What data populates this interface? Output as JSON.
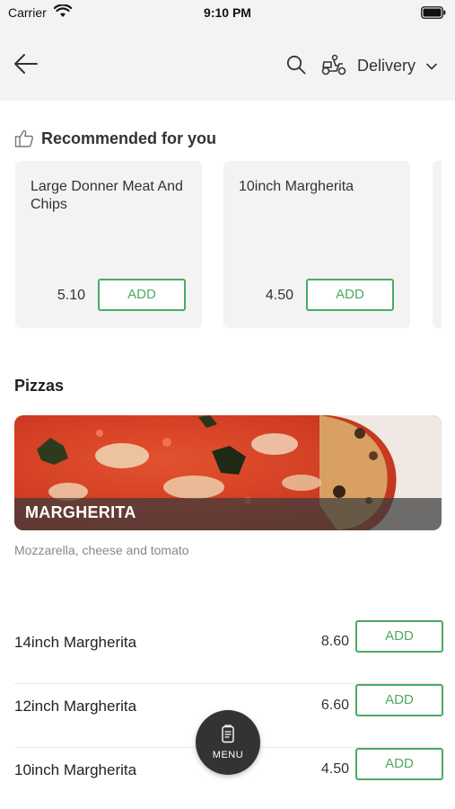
{
  "status_bar": {
    "carrier": "Carrier",
    "time": "9:10 PM"
  },
  "header": {
    "back_icon": "back-arrow-icon",
    "search_icon": "search-icon",
    "delivery_icon": "scooter-icon",
    "delivery_mode": "Delivery",
    "dropdown_icon": "chevron-down-icon"
  },
  "recommended": {
    "title": "Recommended for you",
    "icon": "thumbs-up-icon",
    "items": [
      {
        "name": "Large Donner Meat And Chips",
        "price": "5.10",
        "add_label": "ADD"
      },
      {
        "name": "10inch Margherita",
        "price": "4.50",
        "add_label": "ADD"
      }
    ]
  },
  "section": {
    "title": "Pizzas",
    "banner_label": "MARGHERITA",
    "description": "Mozzarella, cheese and tomato",
    "items": [
      {
        "name": "14inch Margherita",
        "price": "8.60",
        "add_label": "ADD"
      },
      {
        "name": "12inch Margherita",
        "price": "6.60",
        "add_label": "ADD"
      },
      {
        "name": "10inch Margherita",
        "price": "4.50",
        "add_label": "ADD"
      }
    ]
  },
  "fab": {
    "label": "MENU",
    "icon": "menu-card-icon"
  },
  "colors": {
    "accent": "#4caa63",
    "header_bg": "#f3f3f3",
    "fab_bg": "#333333"
  }
}
